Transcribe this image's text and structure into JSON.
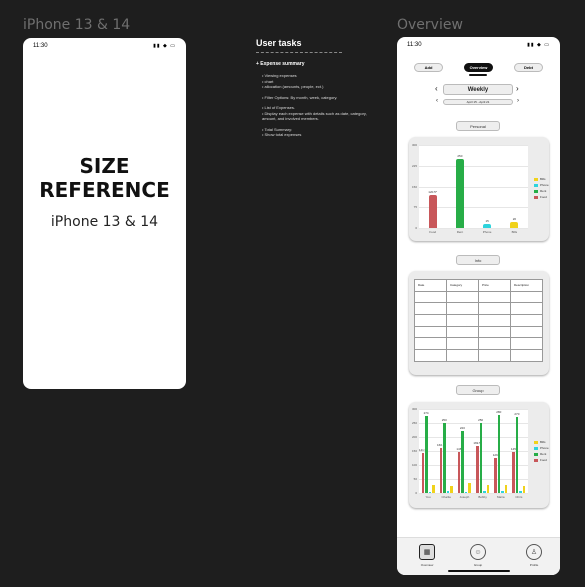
{
  "frames": {
    "left_label": "iPhone 13 & 14",
    "right_label": "Overview"
  },
  "status_bar": {
    "time": "11:30",
    "icons": "▮▮ ◆ ▭"
  },
  "size_reference": {
    "line1": "SIZE",
    "line2": "REFERENCE",
    "subtitle": "iPhone 13 & 14"
  },
  "tasks": {
    "title": "User tasks",
    "heading": "+ Expense summary",
    "items": [
      {
        "text": "Viewing expenses",
        "subs": [
          "chart",
          "allocation (amounts, people, ect.)"
        ]
      },
      {
        "text": "Filter Options: By month, week, category.",
        "subs": []
      },
      {
        "text": "List of Expenses.",
        "subs": [
          "Display each expense with details such as date, category, amount, and involved members."
        ]
      },
      {
        "text": "Total Summary:",
        "subs": [
          "Show total expenses"
        ]
      }
    ]
  },
  "overview": {
    "buttons": {
      "add": "Add",
      "overview": "Overview",
      "debt": "Debt"
    },
    "period": "Weekly",
    "date_range": "April 15 - April 21",
    "sections": {
      "personal": "Personal",
      "info": "Info",
      "group": "Group"
    },
    "table_headers": [
      "Date",
      "Category",
      "Price",
      "Description"
    ],
    "tabs": [
      {
        "label": "Overview",
        "icon": "overview-icon"
      },
      {
        "label": "Group",
        "icon": "group-icon"
      },
      {
        "label": "Profile",
        "icon": "profile-icon"
      }
    ]
  },
  "chart_data": [
    {
      "type": "bar",
      "title": "Personal",
      "categories": [
        "Food",
        "Rent",
        "Phone",
        "Bills"
      ],
      "values": [
        120,
        250,
        15,
        20
      ],
      "bar_labels": [
        "120.5*",
        "250",
        "15",
        "20"
      ],
      "colors": [
        "#c8575a",
        "#27ad47",
        "#2ed3dc",
        "#f0d21b"
      ],
      "yticks": [
        0,
        75,
        150,
        225,
        300
      ],
      "ylim": [
        0,
        300
      ],
      "legend": [
        "Bills",
        "Phone",
        "Rent",
        "Food"
      ],
      "legend_colors": [
        "#f0d21b",
        "#2ed3dc",
        "#27ad47",
        "#c8575a"
      ]
    },
    {
      "type": "bar",
      "title": "Group",
      "categories": [
        "You",
        "Charlie",
        "Joseph",
        "Bobby",
        "Maria",
        "Chris"
      ],
      "series": [
        {
          "name": "Food",
          "values": [
            141.5,
            160.5,
            146,
            169.5,
            126,
            145
          ],
          "color": "#c8575a"
        },
        {
          "name": "Rent",
          "values": [
            274,
            250,
            220,
            250,
            280,
            270
          ],
          "color": "#27ad47"
        },
        {
          "name": "Phone",
          "values": [
            5,
            8,
            5,
            7,
            6,
            7
          ],
          "color": "#2ed3dc"
        },
        {
          "name": "Bills",
          "values": [
            30,
            25,
            35,
            28,
            30,
            25
          ],
          "color": "#f0d21b"
        }
      ],
      "bar_labels": {
        "Food": [
          "141.5",
          "160.5",
          "146",
          "169.5",
          "126",
          "145"
        ],
        "Rent": [
          "274",
          "250",
          "220",
          "250",
          "280",
          "270"
        ]
      },
      "yticks": [
        0,
        50,
        100,
        150,
        200,
        250,
        300
      ],
      "ylim": [
        0,
        300
      ],
      "legend": [
        "Bills",
        "Phone",
        "Rent",
        "Food"
      ],
      "legend_colors": [
        "#f0d21b",
        "#2ed3dc",
        "#27ad47",
        "#c8575a"
      ]
    }
  ]
}
